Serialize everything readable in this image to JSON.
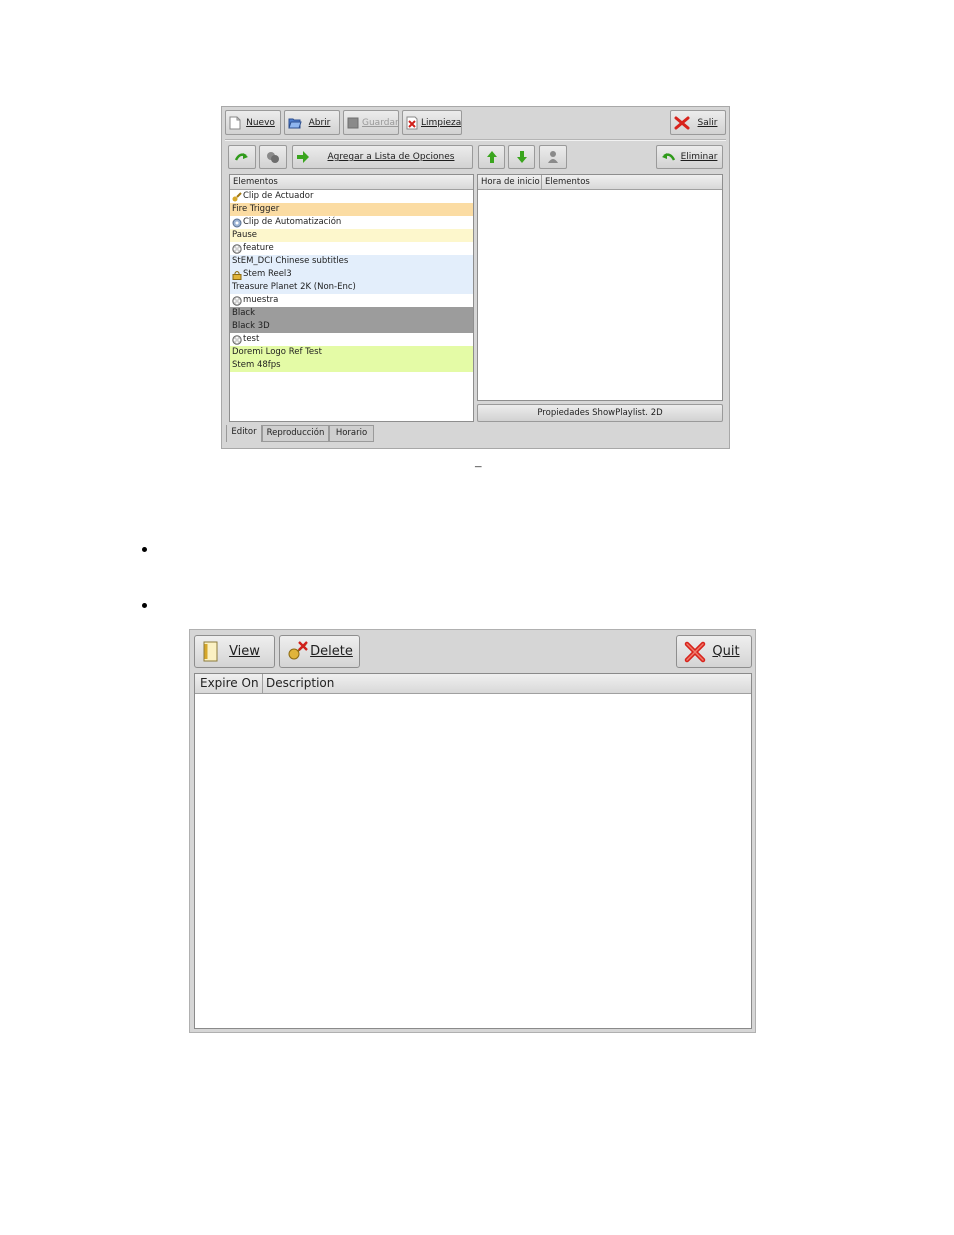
{
  "dash_text": "–",
  "screenshot1": {
    "toolbar": {
      "new_label": "Nuevo",
      "open_label": "Abrir",
      "save_label": "Guardar",
      "clean_label": "Limpieza",
      "exit_label": "Salir"
    },
    "actions": {
      "add_label": "Agregar a Lista de Opciones",
      "remove_label": "Eliminar"
    },
    "left_list": {
      "header": "Elementos",
      "items": [
        {
          "label": "Clip de Actuador",
          "icon": "key-icon",
          "bg": "#ffffff"
        },
        {
          "label": "Fire Trigger",
          "icon": "",
          "bg": "#fbdca3"
        },
        {
          "label": "Clip de Automatización",
          "icon": "gear-icon",
          "bg": "#ffffff"
        },
        {
          "label": "Pause",
          "icon": "",
          "bg": "#fdf7cc"
        },
        {
          "label": "feature",
          "icon": "film-reel-icon",
          "bg": "#ffffff"
        },
        {
          "label": "StEM_DCI Chinese subtitles",
          "icon": "",
          "bg": "#e3eefb"
        },
        {
          "label": "Stem Reel3",
          "icon": "lock-icon",
          "bg": "#e3eefb"
        },
        {
          "label": "Treasure Planet 2K (Non-Enc)",
          "icon": "",
          "bg": "#e3eefb"
        },
        {
          "label": "muestra",
          "icon": "film-reel-icon",
          "bg": "#ffffff"
        },
        {
          "label": "Black",
          "icon": "",
          "bg": "#9c9c9c"
        },
        {
          "label": "Black 3D",
          "icon": "",
          "bg": "#9c9c9c"
        },
        {
          "label": "test",
          "icon": "film-reel-icon",
          "bg": "#ffffff"
        },
        {
          "label": "Doremi Logo Ref Test",
          "icon": "",
          "bg": "#e4fba6"
        },
        {
          "label": "Stem 48fps",
          "icon": "",
          "bg": "#e4fba6"
        }
      ]
    },
    "right_list": {
      "col_start": "Hora de inicio",
      "col_elements": "Elementos"
    },
    "properties_button": "Propiedades ShowPlaylist. 2D",
    "tabs": [
      "Editor",
      "Reproducción",
      "Horario"
    ]
  },
  "screenshot2": {
    "view_label": "View",
    "delete_label": "Delete",
    "quit_label": "Quit",
    "col_expire": "Expire On",
    "col_description": "Description"
  }
}
